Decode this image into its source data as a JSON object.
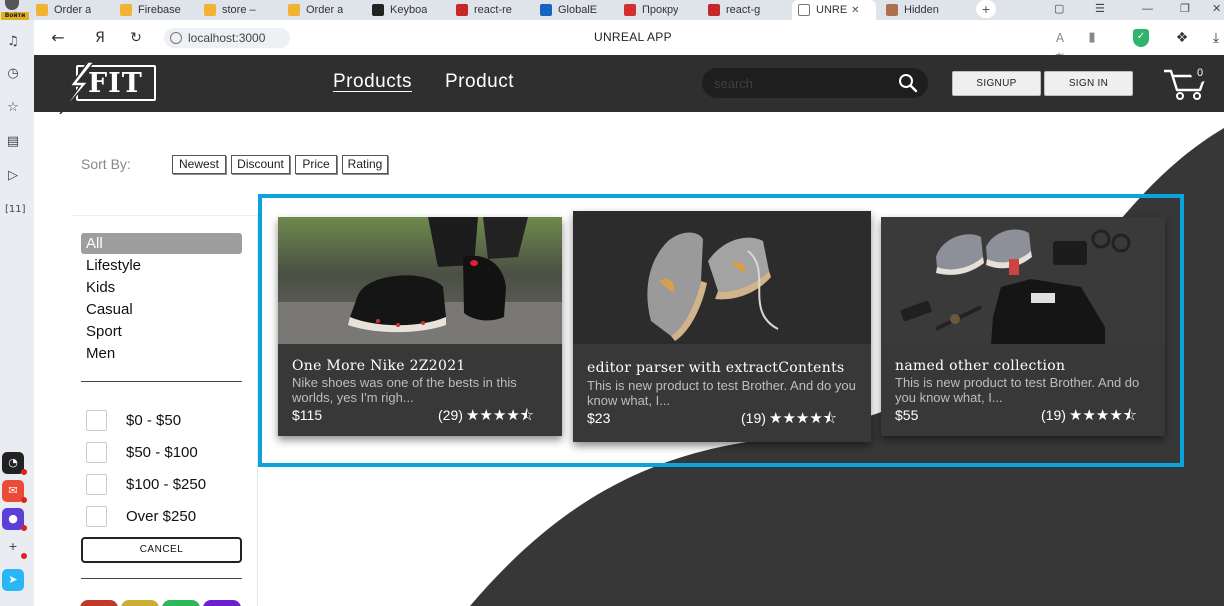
{
  "browser": {
    "profile_badge": "Войти",
    "tabs": [
      {
        "label": "Order a",
        "color": "#f2b233"
      },
      {
        "label": "Firebase",
        "color": "#f2b233"
      },
      {
        "label": "store –",
        "color": "#f2b233"
      },
      {
        "label": "Order a",
        "color": "#f2b233"
      },
      {
        "label": "Keyboa",
        "color": "#222222"
      },
      {
        "label": "react-re",
        "color": "#c62828"
      },
      {
        "label": "GlobalE",
        "color": "#1565c0"
      },
      {
        "label": "Прокру",
        "color": "#d32f2f"
      },
      {
        "label": "react-g",
        "color": "#c62828"
      },
      {
        "label": "UNRE",
        "color": "#ffffff",
        "active": true
      },
      {
        "label": "Hidden",
        "color": "#b07050"
      }
    ],
    "url": "localhost:3000",
    "page_title": "UNREAL APP",
    "counter_icon": "[11]"
  },
  "header": {
    "logo_text": "FIT",
    "nav": {
      "products": "Products",
      "product": "Product"
    },
    "search_placeholder": "search",
    "signup": "SIGNUP",
    "signin": "SIGN IN",
    "cart_count": "0"
  },
  "sort": {
    "label": "Sort By:",
    "options": [
      "Newest",
      "Discount",
      "Price",
      "Rating"
    ]
  },
  "filters": {
    "categories": [
      "All",
      "Lifestyle",
      "Kids",
      "Casual",
      "Sport",
      "Men"
    ],
    "active_category": "All",
    "price_ranges": [
      "$0 - $50",
      "$50 - $100",
      "$100 - $250",
      "Over $250"
    ],
    "cancel": "CANCEL",
    "color_swatches": [
      "#c0392b",
      "#c9b030",
      "#2eb85c",
      "#6a1fd0"
    ]
  },
  "products": [
    {
      "name": "One More Nike 2Z2021",
      "description": "Nike shoes was one of the bests in this worlds, yes I'm righ...",
      "price": "$115",
      "reviews": "(29)",
      "stars": 4.5
    },
    {
      "name": "editor parser with extractContents",
      "description": "This is new product to test Brother. And do you know what, I...",
      "price": "$23",
      "reviews": "(19)",
      "stars": 4.5
    },
    {
      "name": "named other collection",
      "description": "This is new product to test Brother. And do you know what, I...",
      "price": "$55",
      "reviews": "(19)",
      "stars": 4.5
    }
  ]
}
